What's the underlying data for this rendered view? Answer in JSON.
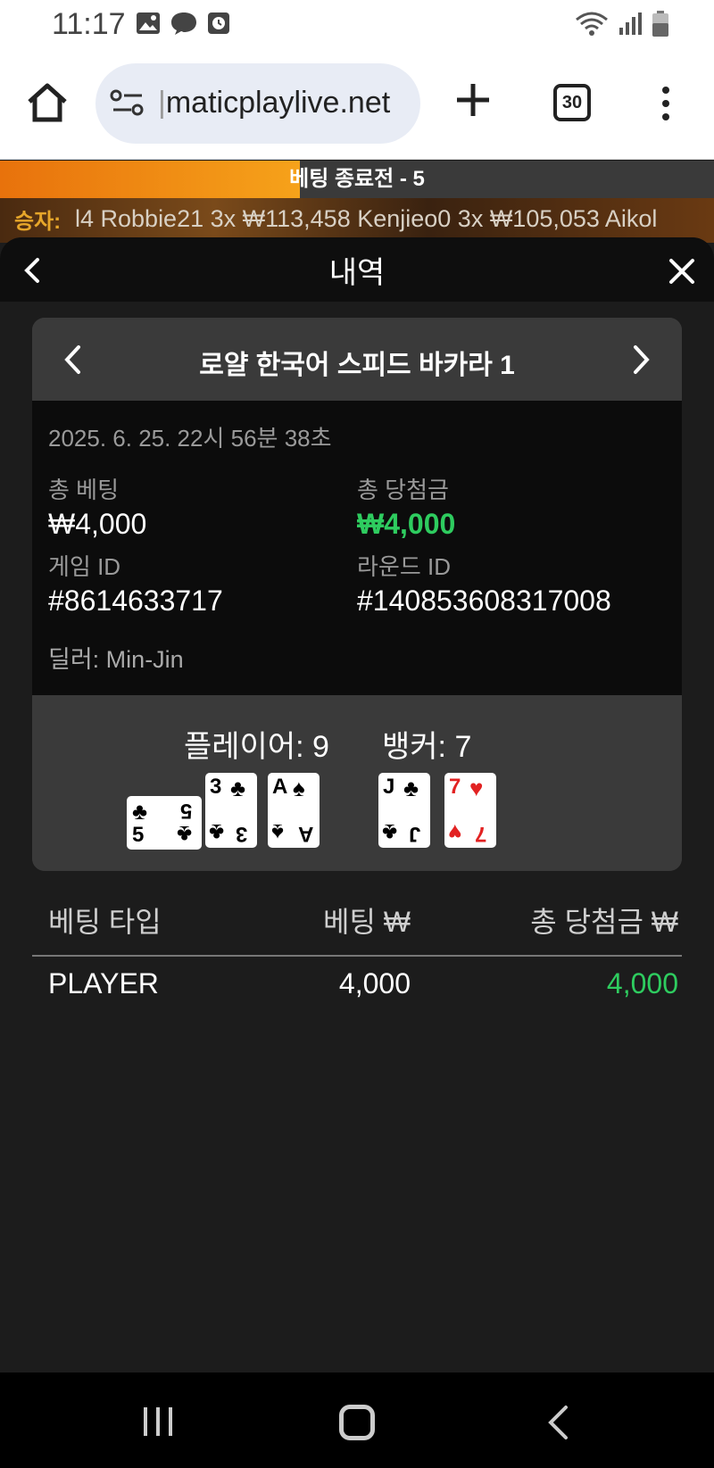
{
  "status_bar": {
    "time": "11:17"
  },
  "browser": {
    "url_faded": "|",
    "url": "maticplaylive.net",
    "tab_count": "30"
  },
  "betting_bar": {
    "text": "베팅 종료전 - 5",
    "progress_percent": 42
  },
  "winners": {
    "label": "승자:",
    "ticker": "l4 Robbie21 3x   ₩113,458 Kenjieo0 3x   ₩105,053 Aikol"
  },
  "modal": {
    "title": "내역"
  },
  "game": {
    "name": "로얄 한국어 스피드 바카라 1",
    "datetime": "2025. 6. 25. 22시 56분 38초",
    "total_bet_label": "총 베팅",
    "total_bet": "₩4,000",
    "total_win_label": "총 당첨금",
    "total_win": "₩4,000",
    "game_id_label": "게임 ID",
    "game_id": "#8614633717",
    "round_id_label": "라운드 ID",
    "round_id": "#140853608317008",
    "dealer": "딜러: Min-Jin",
    "player_score": "플레이어: 9",
    "banker_score": "뱅커: 7",
    "player_cards": [
      {
        "rank": "5",
        "suit": "♣",
        "color": "#000000"
      },
      {
        "rank": "3",
        "suit": "♣",
        "color": "#000000"
      },
      {
        "rank": "A",
        "suit": "♠",
        "color": "#000000"
      }
    ],
    "banker_cards": [
      {
        "rank": "J",
        "suit": "♣",
        "color": "#000000"
      },
      {
        "rank": "7",
        "suit": "♥",
        "color": "#e22222"
      }
    ]
  },
  "bets": {
    "headers": {
      "type": "베팅 타입",
      "amount": "베팅 ₩",
      "win": "총 당첨금 ₩"
    },
    "rows": [
      {
        "type": "PLAYER",
        "amount": "4,000",
        "win": "4,000"
      }
    ]
  },
  "colors": {
    "win_green": "#2ecc5f",
    "progress_orange": "#f6a21a"
  }
}
